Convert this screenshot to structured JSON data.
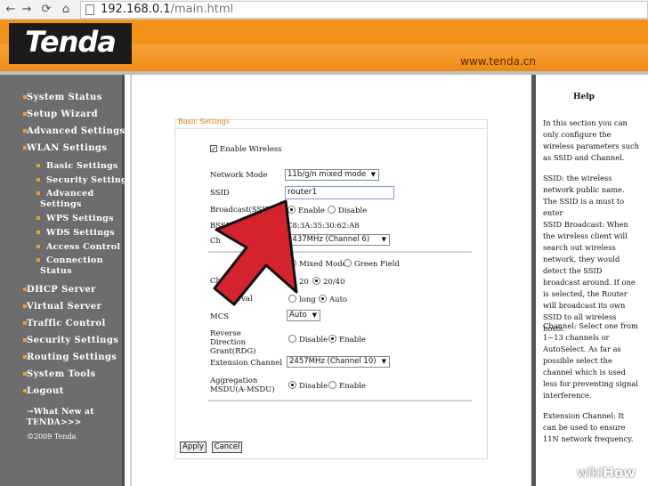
{
  "browser": {
    "url_host": "192.168.0.1",
    "url_path": "/main.html",
    "icons": [
      "back-icon",
      "forward-icon",
      "reload-icon",
      "home-icon"
    ]
  },
  "header": {
    "logo": "Tenda",
    "site": "www.tenda.cn"
  },
  "sidebar": {
    "items": [
      {
        "label": "System Status"
      },
      {
        "label": "Setup Wizard"
      },
      {
        "label": "Advanced Settings"
      },
      {
        "label": "WLAN Settings"
      }
    ],
    "subitems": [
      {
        "label": "Basic Settings"
      },
      {
        "label": "Security Settings"
      },
      {
        "label": "Advanced Settings"
      },
      {
        "label": "WPS Settings"
      },
      {
        "label": "WDS Settings"
      },
      {
        "label": "Access Control"
      },
      {
        "label": "Connection Status"
      }
    ],
    "items2": [
      {
        "label": "DHCP Server"
      },
      {
        "label": "Virtual Server"
      },
      {
        "label": "Traffic Control"
      },
      {
        "label": "Security Settings"
      },
      {
        "label": "Routing Settings"
      },
      {
        "label": "System Tools"
      },
      {
        "label": "Logout"
      }
    ],
    "whats_new": "→What New at TENDA>>>",
    "copyright": "©2009 Tenda"
  },
  "form": {
    "title": "Basic Settings",
    "enable_wireless": "Enable Wireless",
    "network_mode_label": "Network Mode",
    "network_mode_value": "11b/g/n mixed mode",
    "ssid_label": "SSID",
    "ssid_value": "router1",
    "broadcast_label": "Broadcast(SSID)",
    "broadcast_enable": "Enable",
    "broadcast_disable": "Disable",
    "bssid_label": "BSSID",
    "bssid_value": "C8:3A:35:30:62:A8",
    "channel_label": "Ch",
    "channel_value": "2437MHz (Channel 6)",
    "mode_mixed": "Mixed Mode",
    "mode_green": "Green Field",
    "bw_label": "Ch",
    "bw_20": "20",
    "bw_2040": "20/40",
    "gi_label": "erval",
    "gi_long": "long",
    "gi_auto": "Auto",
    "mcs_label": "MCS",
    "mcs_value": "Auto",
    "rdg_label": "Reverse Direction Grant(RDG)",
    "rdg_disable": "Disable",
    "rdg_enable": "Enable",
    "ext_label": "Extension Channel",
    "ext_value": "2457MHz (Channel 10)",
    "amsdu_label": "Aggregation MSDU(A-MSDU)",
    "amsdu_disable": "Disable",
    "amsdu_enable": "Enable",
    "apply": "Apply",
    "cancel": "Cancel"
  },
  "help": {
    "title": "Help",
    "p1": "In this section you can only configure the wireless parameters such as SSID and Channel.",
    "p2": "SSID: the wireless network public name. The SSID is a must to enter",
    "p3": "SSID Broadcast: When the wireless client will search out wireless network, they would detect the SSID broadcast around. If one is selected, the Router will broadcast its own SSID to all wireless hosts.",
    "p4": "Channel: Select one from 1~13 channels or AutoSelect. As far as possible select the channel which is used less for preventing signal interference.",
    "p5": "Extension Channel: It can be used to ensure 11N network frequency."
  },
  "watermark": {
    "wiki": "wiki",
    "how": "How"
  },
  "colors": {
    "orange": "#f2921b",
    "sidebar": "#6d6d6d",
    "arrow": "#d5232e"
  }
}
